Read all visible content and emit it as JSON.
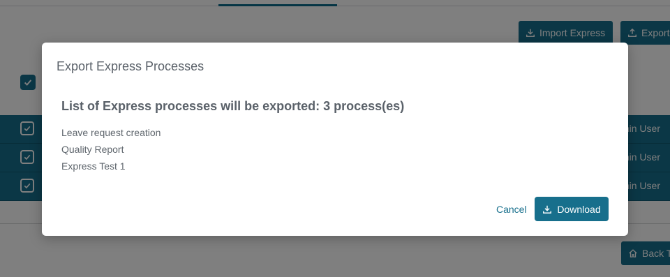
{
  "background": {
    "toolbar": {
      "import_label": "Import Express",
      "export_label": "Export"
    },
    "rows": [
      {
        "user": "Admin User"
      },
      {
        "user": "Admin User"
      },
      {
        "user": "Admin User"
      }
    ],
    "back_label": "Back To"
  },
  "modal": {
    "title": "Export Express Processes",
    "heading": "List of Express processes will be exported: 3 process(es)",
    "processes": [
      "Leave request creation",
      "Quality Report",
      "Express Test 1"
    ],
    "cancel_label": "Cancel",
    "download_label": "Download"
  },
  "colors": {
    "accent": "#176f8c",
    "overlay": "rgba(0,0,0,0.5)"
  },
  "icons": [
    "download-icon",
    "upload-icon",
    "home-icon",
    "checkbox-checked-icon"
  ]
}
